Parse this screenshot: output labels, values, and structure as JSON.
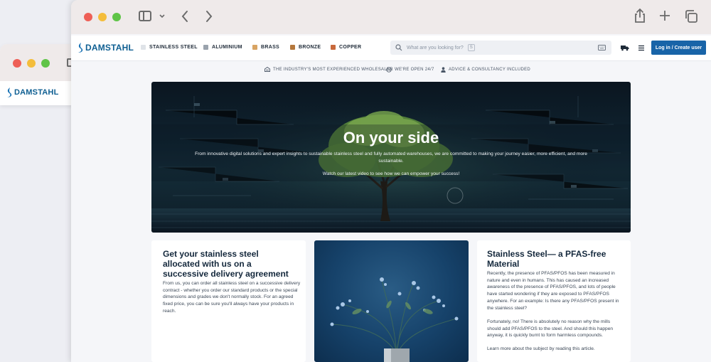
{
  "background_window": {
    "logo_text": "DAMSTAHL"
  },
  "site": {
    "logo_text": "DAMSTAHL",
    "nav": [
      {
        "label": "STAINLESS STEEL",
        "swatch": "#dfe3e8"
      },
      {
        "label": "ALUMINIUM",
        "swatch": "#9aa3ad"
      },
      {
        "label": "BRASS",
        "swatch": "#d8a463"
      },
      {
        "label": "BRONZE",
        "swatch": "#b4773c"
      },
      {
        "label": "COPPER",
        "swatch": "#c8693c"
      }
    ],
    "search_placeholder": "What are you looking for?",
    "search_shortcut": "S",
    "login_label": "Log in / Create user",
    "accent_color": "#1864a8"
  },
  "usp": [
    "THE INDUSTRY'S MOST EXPERIENCED WHOLESALER",
    "WE'RE OPEN 24/7",
    "ADVICE & CONSULTANCY INCLUDED"
  ],
  "hero": {
    "title": "On your side",
    "subtitle": "From innovative digital solutions and expert insights to sustainable stainless steel and fully automated warehouses, we are committed to making your journey easier, more efficient, and more sustainable.",
    "cta": "Watch our latest video to see how we can empower your success!"
  },
  "cards": {
    "left": {
      "title": "Get your stainless steel allocated with us on a successive delivery agreement",
      "body": "From us, you can order all stainless steel on a successive delivery contract - whether you order our standard products or the special dimensions and grades we don't normally stock. For an agreed fixed price, you can be sure you'll always have your products in reach."
    },
    "right": {
      "title": "Stainless Steel— a PFAS-free Material",
      "para1": "Recently, the presence of PFAS/PFOS has been measured in nature and even in humans. This has caused an increased awareness of the presence of PFAS/PFOS, and lots of people have started wondering if they are exposed to PFAS/PFOS anywhere. For an example: Is there any PFAS/PFOS present in the stainless steel?",
      "para2": "Fortunately, no! There is absolutely no reason why the mills should add PFAS/PFOS to the steel. And should this happen anyway, it is quickly burnt to form harmless compounds.",
      "para3": "Learn more about the subject by reading this article."
    }
  }
}
